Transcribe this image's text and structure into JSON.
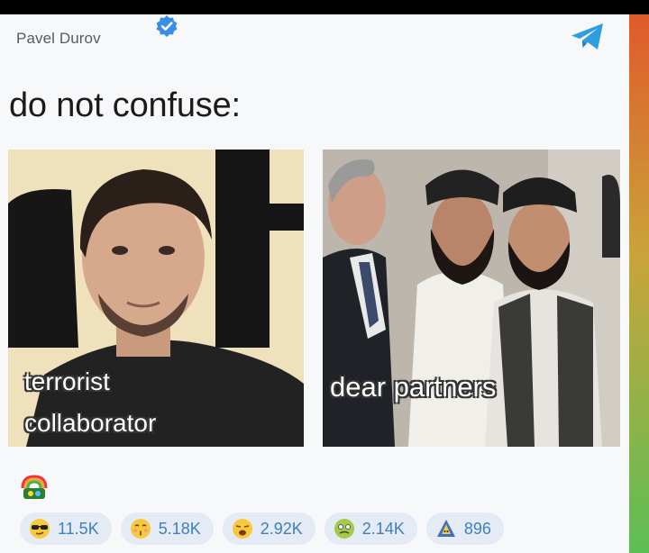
{
  "post": {
    "author": "Pavel Durov",
    "caption": "do not confuse:"
  },
  "meme": {
    "left_label_line1": "terrorist",
    "left_label_line2": "collaborator",
    "right_label": "dear partners"
  },
  "reactions": [
    {
      "icon": "sunglasses-face-icon",
      "count": "11.5K"
    },
    {
      "icon": "kissing-face-icon",
      "count": "5.18K"
    },
    {
      "icon": "weary-face-icon",
      "count": "2.92K"
    },
    {
      "icon": "nauseated-face-icon",
      "count": "2.14K"
    },
    {
      "icon": "alien-monster-icon",
      "count": "896"
    }
  ],
  "colors": {
    "accent": "#3d7fc2",
    "chip_bg": "#e4ebf4",
    "telegram_blue": "#2f9de0"
  }
}
